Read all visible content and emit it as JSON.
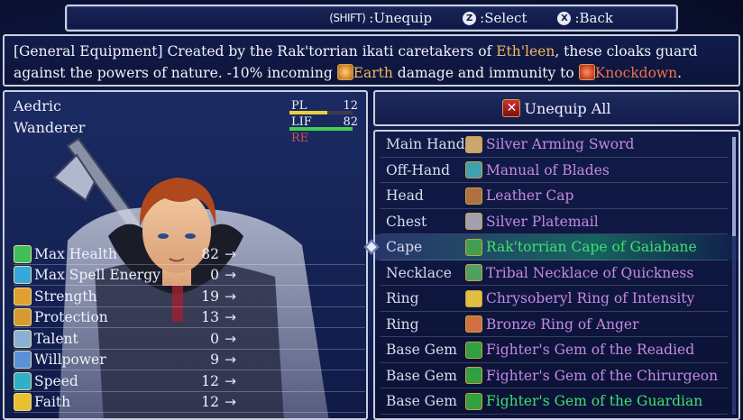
{
  "controls": {
    "unequip_key": "(SHIFT)",
    "unequip_label": ":Unequip",
    "select_glyph": "Z",
    "select_label": ":Select",
    "back_glyph": "X",
    "back_label": ":Back"
  },
  "description": {
    "p1": "[General Equipment] Created by the Rak'torrian ikati caretakers of ",
    "place": "Eth'leen",
    "p2": ", these cloaks guard against the powers of nature. -10% incoming ",
    "element": "Earth",
    "p3": " damage and immunity to ",
    "status": "Knockdown",
    "p4": "."
  },
  "character": {
    "name": "Aedric",
    "class": "Wanderer",
    "pl_label": "PL",
    "pl_value": "12",
    "lf_label": "LIF",
    "lf_value": "82",
    "re_label": "RE"
  },
  "stats": [
    {
      "label": "Max Health",
      "value": "82",
      "arrow": "→",
      "color": "#3fbf5a"
    },
    {
      "label": "Max Spell Energy",
      "value": "0",
      "arrow": "→",
      "color": "#35a8e0"
    },
    {
      "label": "Strength",
      "value": "19",
      "arrow": "→",
      "color": "#e0a030"
    },
    {
      "label": "Protection",
      "value": "13",
      "arrow": "→",
      "color": "#d89a30"
    },
    {
      "label": "Talent",
      "value": "0",
      "arrow": "→",
      "color": "#8ab0d8"
    },
    {
      "label": "Willpower",
      "value": "9",
      "arrow": "→",
      "color": "#5a90d8"
    },
    {
      "label": "Speed",
      "value": "12",
      "arrow": "→",
      "color": "#30b0c8"
    },
    {
      "label": "Faith",
      "value": "12",
      "arrow": "→",
      "color": "#e8c030"
    }
  ],
  "unequip_all": "Unequip All",
  "equipment": [
    {
      "slot": "Main Hand",
      "item": "Silver Arming Sword",
      "color": "#c58ae0",
      "icon_color": "#c8a870"
    },
    {
      "slot": "Off-Hand",
      "item": "Manual of Blades",
      "color": "#c58ae0",
      "icon_color": "#40a0b0"
    },
    {
      "slot": "Head",
      "item": "Leather Cap",
      "color": "#c58ae0",
      "icon_color": "#b07040"
    },
    {
      "slot": "Chest",
      "item": "Silver Platemail",
      "color": "#c58ae0",
      "icon_color": "#a0a0b0"
    },
    {
      "slot": "Cape",
      "item": "Rak'torrian Cape of Gaiabane",
      "color": "#40e070",
      "icon_color": "#40a050"
    },
    {
      "slot": "Necklace",
      "item": "Tribal Necklace of Quickness",
      "color": "#c58ae0",
      "icon_color": "#50a060"
    },
    {
      "slot": "Ring",
      "item": "Chrysoberyl Ring of Intensity",
      "color": "#c58ae0",
      "icon_color": "#e0c040"
    },
    {
      "slot": "Ring",
      "item": "Bronze Ring of Anger",
      "color": "#c58ae0",
      "icon_color": "#d07040"
    },
    {
      "slot": "Base Gem",
      "item": "Fighter's Gem of the Readied",
      "color": "#c58ae0",
      "icon_color": "#30a040"
    },
    {
      "slot": "Base Gem",
      "item": "Fighter's Gem of the Chirurgeon",
      "color": "#c58ae0",
      "icon_color": "#30a040"
    },
    {
      "slot": "Base Gem",
      "item": "Fighter's Gem of the Guardian",
      "color": "#40e070",
      "icon_color": "#30a040"
    }
  ],
  "selected_index": 4,
  "bar_levels": {
    "pl": 0.6,
    "lf": 1.0
  }
}
